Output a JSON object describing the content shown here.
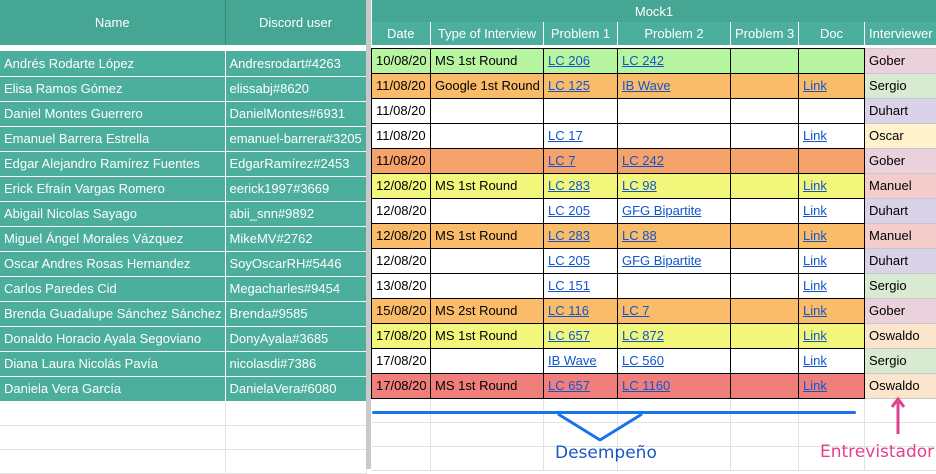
{
  "left": {
    "headers": [
      "Name",
      "Discord user"
    ],
    "rows": [
      {
        "name": "Andrés Rodarte López",
        "discord": "Andresrodart#4263"
      },
      {
        "name": "Elisa Ramos Gómez",
        "discord": "elissabj#8620"
      },
      {
        "name": "Daniel Montes Guerrero",
        "discord": "DanielMontes#6931"
      },
      {
        "name": "Emanuel Barrera Estrella",
        "discord": "emanuel-barrera#3205"
      },
      {
        "name": "Edgar Alejandro Ramírez Fuentes",
        "discord": "EdgarRamírez#2453"
      },
      {
        "name": "Erick Efraín Vargas Romero",
        "discord": "eerick1997#3669"
      },
      {
        "name": "Abigail Nicolas Sayago",
        "discord": "abii_snn#9892"
      },
      {
        "name": "Miguel Ángel Morales Vázquez",
        "discord": "MikeMV#2762"
      },
      {
        "name": "Oscar Andres Rosas Hernandez",
        "discord": "SoyOscarRH#5446"
      },
      {
        "name": "Carlos Paredes Cid",
        "discord": "Megacharles#9454"
      },
      {
        "name": "Brenda Guadalupe Sánchez Sánchez",
        "discord": "Brenda#9585"
      },
      {
        "name": "Donaldo Horacio Ayala Segoviano",
        "discord": "DonyAyala#3685"
      },
      {
        "name": "Diana Laura Nicolás Pavía",
        "discord": "nicolasdi#7386"
      },
      {
        "name": "Daniela Vera García",
        "discord": "DanielaVera#6080"
      }
    ]
  },
  "right": {
    "group_title": "Mock1",
    "headers": [
      "Date",
      "Type of Interview",
      "Problem 1",
      "Problem 2",
      "Problem 3",
      "Doc",
      "Interviewer"
    ],
    "rows": [
      {
        "date": "10/08/20",
        "type": "MS 1st Round",
        "p1": "LC 206",
        "p2": "LC 242",
        "p3": "",
        "doc": "",
        "interviewer": "Gober",
        "color": "#b7f5a0",
        "iv_color": "#ead1dc"
      },
      {
        "date": "11/08/20",
        "type": "Google 1st Round",
        "p1": "LC 125",
        "p2": "IB Wave",
        "p3": "",
        "doc": "Link",
        "interviewer": "Sergio",
        "color": "#fbbc69",
        "iv_color": "#d9ead3"
      },
      {
        "date": "11/08/20",
        "type": "",
        "p1": "",
        "p2": "",
        "p3": "",
        "doc": "",
        "interviewer": "Duhart",
        "color": "#ffffff",
        "iv_color": "#d9d2e9"
      },
      {
        "date": "11/08/20",
        "type": "",
        "p1": "LC 17",
        "p2": "",
        "p3": "",
        "doc": "Link",
        "interviewer": "Oscar",
        "color": "#ffffff",
        "iv_color": "#fff2cc"
      },
      {
        "date": "11/08/20",
        "type": "",
        "p1": "LC 7",
        "p2": "LC 242",
        "p3": "",
        "doc": "",
        "interviewer": "Gober",
        "color": "#f6a36b",
        "iv_color": "#ead1dc"
      },
      {
        "date": "12/08/20",
        "type": "MS 1st Round",
        "p1": "LC 283",
        "p2": "LC 98",
        "p3": "",
        "doc": "Link",
        "interviewer": "Manuel",
        "color": "#f2f77c",
        "iv_color": "#f4cccc"
      },
      {
        "date": "12/08/20",
        "type": "",
        "p1": "LC 205",
        "p2": "GFG Bipartite",
        "p3": "",
        "doc": "Link",
        "interviewer": "Duhart",
        "color": "#ffffff",
        "iv_color": "#d9d2e9"
      },
      {
        "date": "12/08/20",
        "type": "MS 1st Round",
        "p1": "LC 283",
        "p2": "LC 88",
        "p3": "",
        "doc": "Link",
        "interviewer": "Manuel",
        "color": "#fbbc69",
        "iv_color": "#f4cccc"
      },
      {
        "date": "12/08/20",
        "type": "",
        "p1": "LC 205",
        "p2": "GFG Bipartite",
        "p3": "",
        "doc": "Link",
        "interviewer": "Duhart",
        "color": "#ffffff",
        "iv_color": "#d9d2e9"
      },
      {
        "date": "13/08/20",
        "type": "",
        "p1": "LC 151",
        "p2": "",
        "p3": "",
        "doc": "Link",
        "interviewer": "Sergio",
        "color": "#ffffff",
        "iv_color": "#d9ead3"
      },
      {
        "date": "15/08/20",
        "type": "MS 2st Round",
        "p1": "LC 116",
        "p2": "LC 7",
        "p3": "",
        "doc": "Link",
        "interviewer": "Gober",
        "color": "#fbbc69",
        "iv_color": "#ead1dc"
      },
      {
        "date": "17/08/20",
        "type": "MS 1st Round",
        "p1": "LC 657",
        "p2": "LC 872",
        "p3": "",
        "doc": "Link",
        "interviewer": "Oswaldo",
        "color": "#f2f77c",
        "iv_color": "#fce5cd"
      },
      {
        "date": "17/08/20",
        "type": "",
        "p1": "IB Wave",
        "p2": "LC 560",
        "p3": "",
        "doc": "Link",
        "interviewer": "Sergio",
        "color": "#ffffff",
        "iv_color": "#d9ead3"
      },
      {
        "date": "17/08/20",
        "type": "MS 1st Round",
        "p1": "LC 657",
        "p2": "LC 1160",
        "p3": "",
        "doc": "Link",
        "interviewer": "Oswaldo",
        "color": "#f07f7b",
        "iv_color": "#fce5cd"
      }
    ]
  },
  "annotations": {
    "performance_label": "Desempeño",
    "interviewer_label": "Entrevistador",
    "performance_color": "#1a73e8",
    "interviewer_color": "#e23f8c"
  }
}
